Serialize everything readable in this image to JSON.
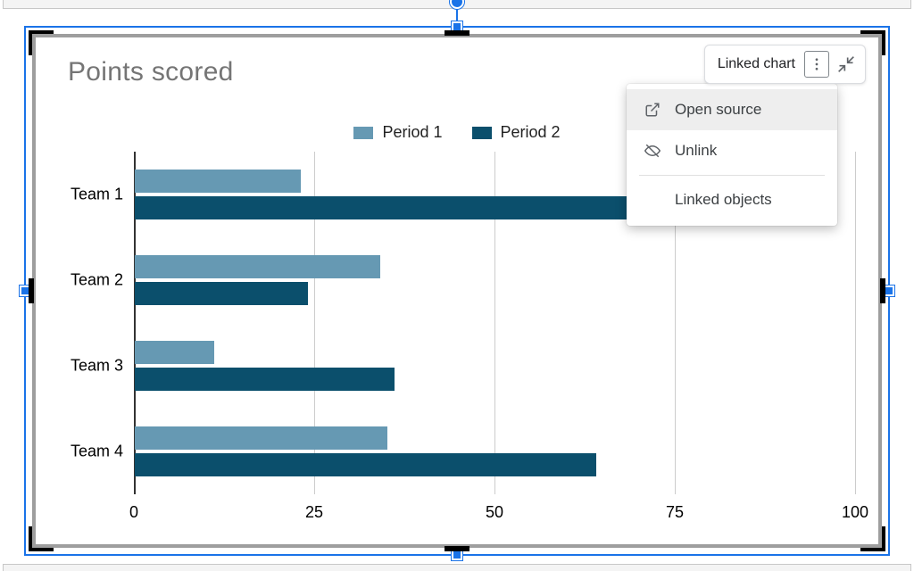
{
  "linked_chip": {
    "label": "Linked chart"
  },
  "menu": {
    "open_source": "Open source",
    "unlink": "Unlink",
    "linked_objects": "Linked objects"
  },
  "chart_data": {
    "type": "bar",
    "orientation": "horizontal",
    "title": "Points scored",
    "xlabel": "",
    "ylabel": "",
    "xlim": [
      0,
      100
    ],
    "xticks": [
      0,
      25,
      50,
      75,
      100
    ],
    "categories": [
      "Team 1",
      "Team 2",
      "Team 3",
      "Team 4"
    ],
    "series": [
      {
        "name": "Period 1",
        "color": "#6699b3",
        "values": [
          23,
          34,
          11,
          35
        ]
      },
      {
        "name": "Period 2",
        "color": "#0b4f6c",
        "values": [
          88,
          24,
          36,
          64
        ]
      }
    ]
  }
}
